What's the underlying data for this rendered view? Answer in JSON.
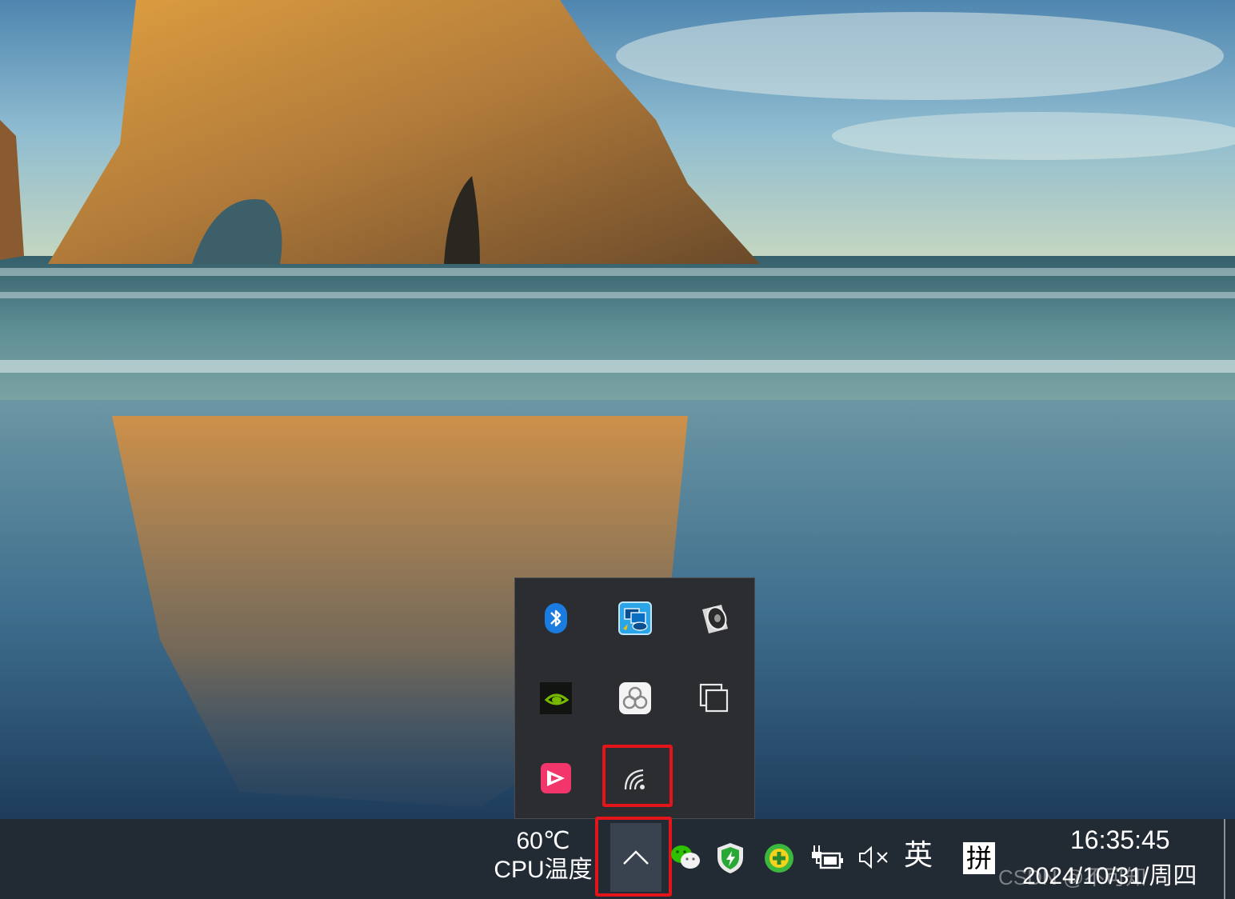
{
  "desktop": {
    "wallpaper_icon": "sea-arch-landscape-wallpaper"
  },
  "tray_popup": {
    "icons": [
      {
        "name": "bluetooth-icon"
      },
      {
        "name": "intel-graphics-icon"
      },
      {
        "name": "speaker-icon"
      },
      {
        "name": "nvidia-icon"
      },
      {
        "name": "cloud-sync-icon"
      },
      {
        "name": "copy-windows-icon"
      },
      {
        "name": "pink-app-icon"
      },
      {
        "name": "wireless-hotspot-icon"
      }
    ],
    "highlight_color": "#e3141a"
  },
  "taskbar": {
    "cpu_temp_value": "60℃",
    "cpu_temp_label": "CPU温度",
    "show_hidden_icons": "chevron-up-icon",
    "icons": [
      "wechat-icon",
      "security-shield-icon",
      "green-plus-icon",
      "power-battery-icon",
      "volume-muted-icon"
    ],
    "ime_lang": "英",
    "ime_mode": "拼",
    "clock_time": "16:35:45",
    "clock_date": "2024/10/31/周四",
    "watermark": "CSDN @不可知"
  },
  "colors": {
    "taskbar_bg": "#222a34",
    "popup_bg": "#2b2d31",
    "chevron_bg": "#39434f"
  }
}
